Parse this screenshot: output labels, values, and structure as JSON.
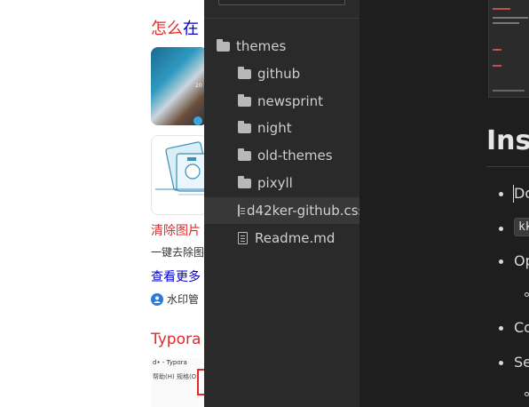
{
  "search_results": {
    "result1": {
      "title_highlight": "怎么",
      "title_rest": "在",
      "thumb_tag": "20"
    },
    "result2": {
      "link_highlight": "清除图片",
      "link_rest": "",
      "description": "一键去除图",
      "more_link": "查看更多",
      "source": "水印管"
    },
    "result3": {
      "title": "Typora",
      "thumb_line1": "d• - Typora",
      "thumb_line2": "帮助(H)  规格(O)"
    }
  },
  "sidebar": {
    "tree": [
      {
        "label": "themes",
        "type": "folder",
        "selected": false
      },
      {
        "label": "github",
        "type": "folder",
        "selected": false
      },
      {
        "label": "newsprint",
        "type": "folder",
        "selected": false
      },
      {
        "label": "night",
        "type": "folder",
        "selected": false
      },
      {
        "label": "old-themes",
        "type": "folder",
        "selected": false
      },
      {
        "label": "pixyll",
        "type": "folder",
        "selected": false
      },
      {
        "label": "d42ker-github.css",
        "type": "file",
        "selected": true
      },
      {
        "label": "Readme.md",
        "type": "file",
        "selected": false
      }
    ]
  },
  "editor": {
    "heading": "Inst",
    "items": [
      {
        "text": "Do",
        "style": "bullet"
      },
      {
        "text": "kk",
        "style": "bullet-code"
      },
      {
        "text": "Op",
        "style": "bullet"
      },
      {
        "text": "",
        "style": "sub-bullet"
      },
      {
        "text": "Co",
        "style": "bullet"
      },
      {
        "text": "Se",
        "style": "bullet"
      },
      {
        "text": "",
        "style": "sub-bullet"
      }
    ]
  },
  "colors": {
    "link": "#0000cc",
    "highlight": "#e02b2b",
    "sidebar_bg": "#2a2a2a",
    "editor_bg": "#1e1e1e"
  }
}
